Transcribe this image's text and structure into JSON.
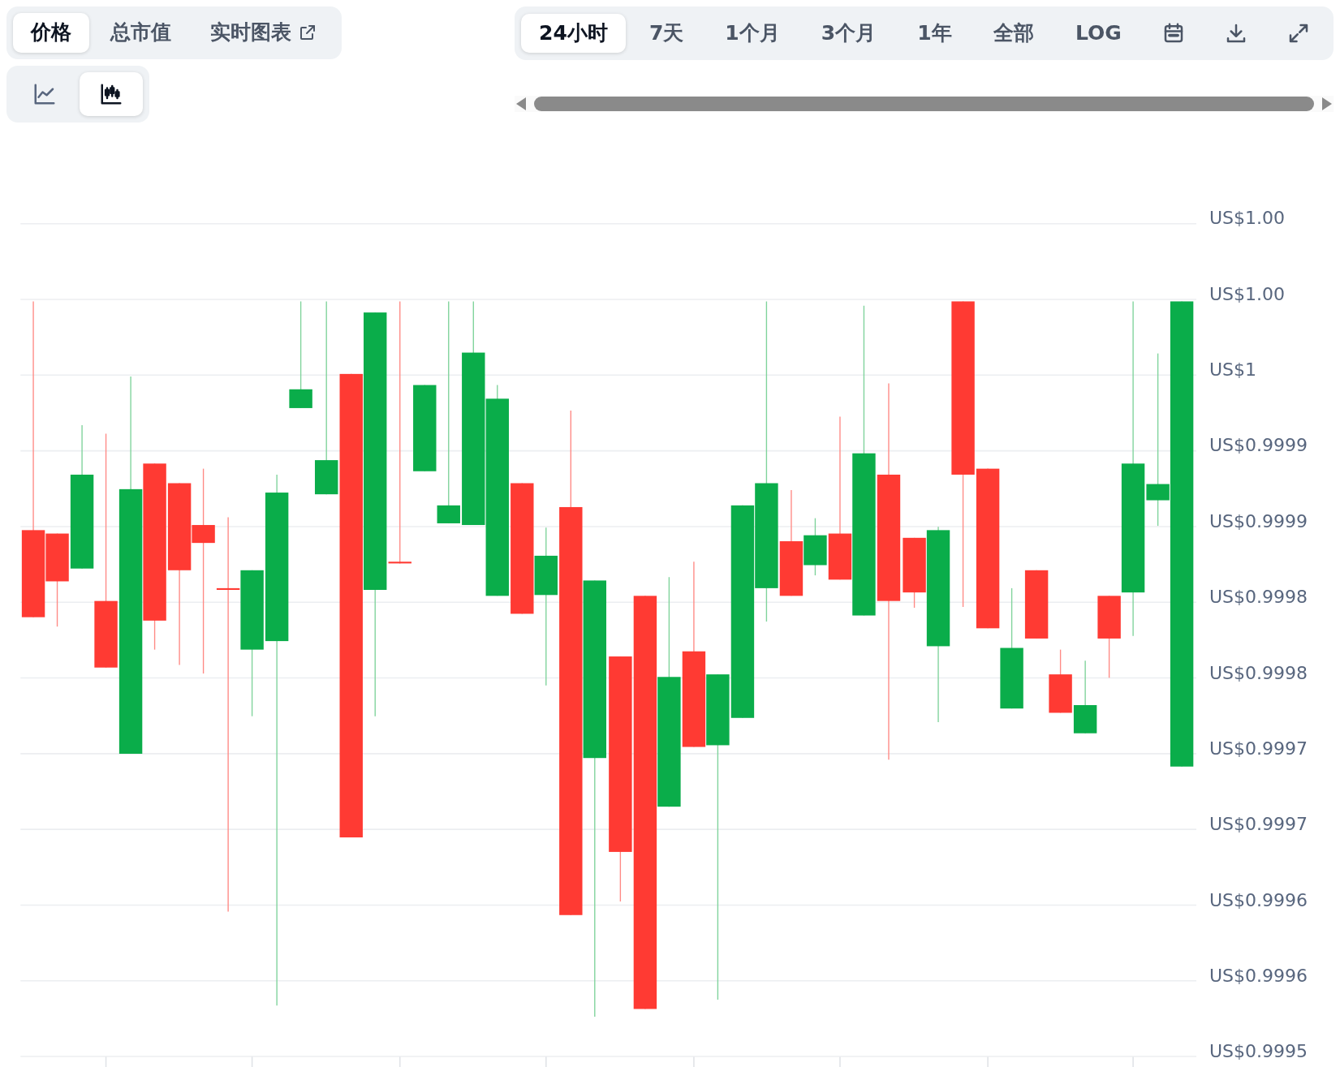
{
  "metric_tabs": [
    {
      "label": "价格",
      "selected": true,
      "external": false
    },
    {
      "label": "总市值",
      "selected": false,
      "external": false
    },
    {
      "label": "实时图表",
      "selected": false,
      "external": true
    }
  ],
  "chart_type_toggle": [
    {
      "kind": "line",
      "selected": false
    },
    {
      "kind": "candlestick",
      "selected": true
    }
  ],
  "range_tabs": [
    {
      "label": "24小时",
      "selected": true
    },
    {
      "label": "7天",
      "selected": false
    },
    {
      "label": "1个月",
      "selected": false
    },
    {
      "label": "3个月",
      "selected": false
    },
    {
      "label": "1年",
      "selected": false
    },
    {
      "label": "全部",
      "selected": false
    },
    {
      "label": "LOG",
      "selected": false
    }
  ],
  "y_axis_labels": [
    "US$1.00",
    "US$1.00",
    "US$1",
    "US$0.9999",
    "US$0.9999",
    "US$0.9998",
    "US$0.9998",
    "US$0.9997",
    "US$0.9997",
    "US$0.9996",
    "US$0.9996",
    "US$0.9995"
  ]
}
